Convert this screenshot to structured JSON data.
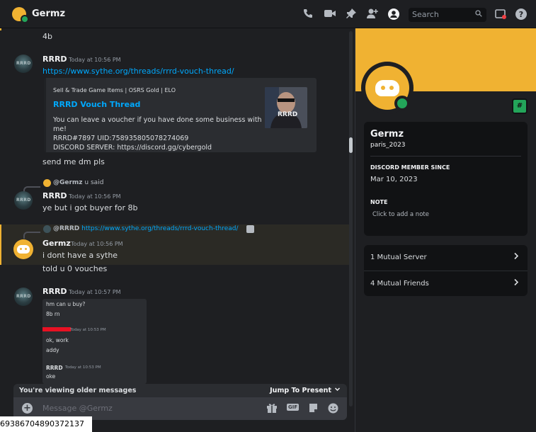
{
  "header": {
    "title": "Germz",
    "search_placeholder": "Search",
    "icons": [
      "phone-call-icon",
      "video-icon",
      "pin-icon",
      "add-friend-icon",
      "profile-toggle-icon",
      "search-icon",
      "inbox-icon",
      "help-icon"
    ]
  },
  "chat": {
    "prev_message": "4b",
    "messages": [
      {
        "author": "RRRD",
        "avatar_tag": "RRRD",
        "time": "Today at 10:56 PM",
        "link": "https://www.sythe.org/threads/rrrd-vouch-thread/",
        "embed": {
          "provider": "Sell & Trade Game Items | OSRS Gold | ELO",
          "title": "RRRD Vouch Thread",
          "description_lines": [
            "You can leave a voucher if you have done some business with me!",
            "RRRD#7897 UID:758935805078274069",
            "DISCORD SERVER: https://discord.gg/cybergold"
          ],
          "thumb_text": "RRRD"
        },
        "followup": "send me dm pls"
      },
      {
        "reply_to": "@Germz",
        "reply_text": "u said",
        "author": "RRRD",
        "avatar_tag": "RRRD",
        "time": "Today at 10:56 PM",
        "text": "ye but i got buyer for 8b"
      },
      {
        "reply_to": "@RRRD",
        "reply_text": "https://www.sythe.org/threads/rrrd-vouch-thread/",
        "author": "Germz",
        "time": "Today at 10:56 PM",
        "text": "i dont have a sythe",
        "followup": "told u 0 vouches"
      },
      {
        "author": "RRRD",
        "avatar_tag": "RRRD",
        "time": "Today at 10:57 PM",
        "screenshot": {
          "line1": "hm can u buy?",
          "line2": "8b rn",
          "time_a": "Today at 10:53 PM",
          "line3": "ok, work",
          "line4": "addy",
          "author2": "RRRD",
          "time_b": "Today at 10:53 PM",
          "line5": "oke"
        }
      }
    ],
    "older_banner": "You're viewing older messages",
    "jump_label": "Jump To Present",
    "composer_placeholder": "Message @Germz",
    "gif_label": "GIF"
  },
  "profile": {
    "display_name": "Germz",
    "username": "paris_2023",
    "member_since_label": "DISCORD MEMBER SINCE",
    "member_since": "Mar 10, 2023",
    "note_label": "NOTE",
    "note_placeholder": "Click to add a note",
    "mutual_servers": "1 Mutual Server",
    "mutual_friends": "4 Mutual Friends"
  },
  "bottom_overlay_text": "69386704890372137",
  "colors": {
    "accent": "#f0b232",
    "link": "#00a8fc",
    "online": "#23a55a",
    "redacted": "#e81123"
  }
}
